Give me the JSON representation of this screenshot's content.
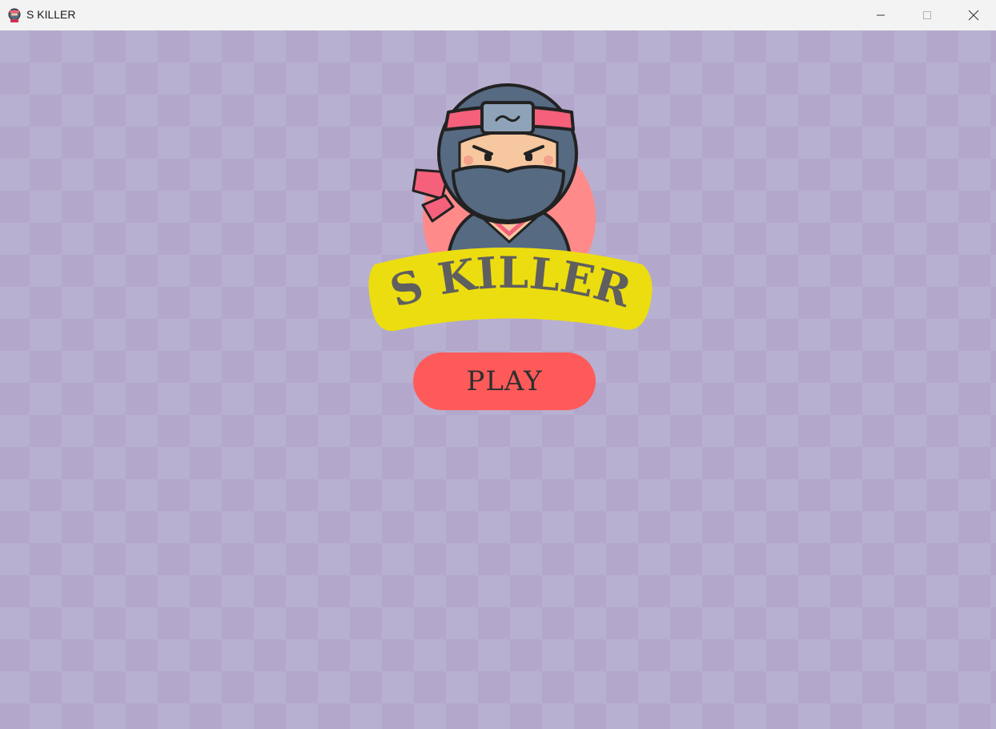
{
  "window": {
    "title": "S KILLER",
    "app_icon": "ninja-icon",
    "controls": [
      "minimize-icon",
      "maximize-icon",
      "close-icon"
    ]
  },
  "game": {
    "logo_title": "S KILLER",
    "play_label": "PLAY"
  },
  "colors": {
    "background_light": "#b8b0d0",
    "background_dark": "#b3a8cc",
    "banner": "#ecdd10",
    "play_button": "#ff5a5a",
    "title_text": "#5f5f5f",
    "ninja_mask": "#566a82",
    "headband": "#f5607a"
  }
}
